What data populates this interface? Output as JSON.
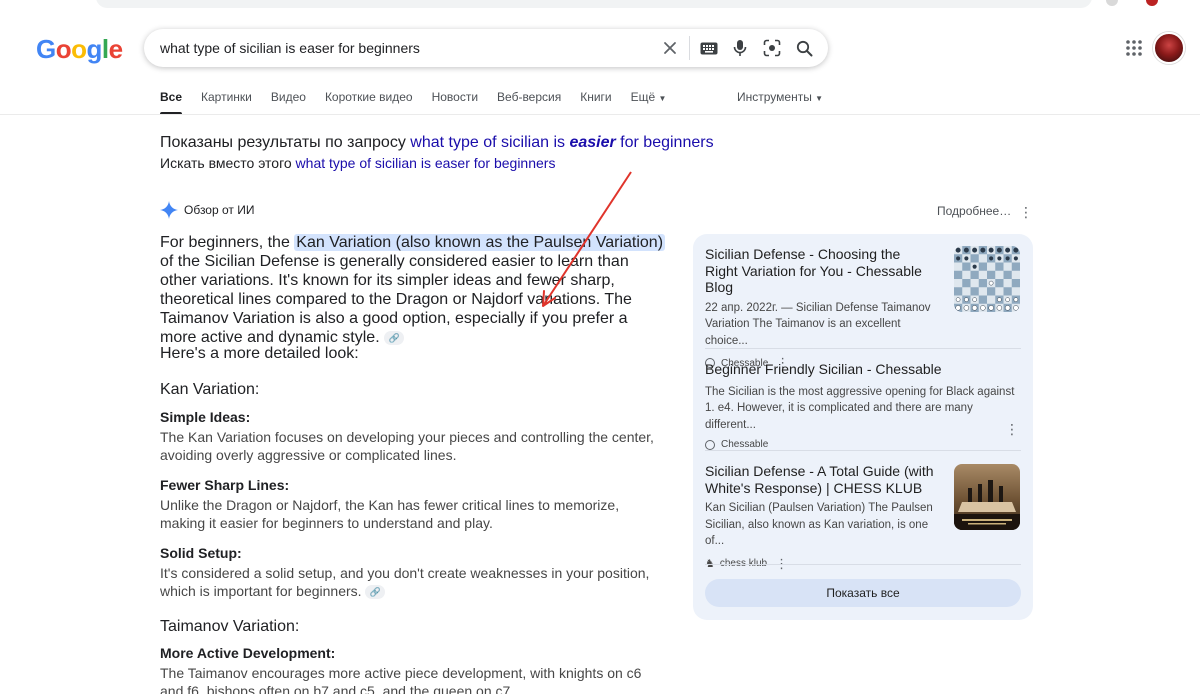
{
  "header": {
    "logo": [
      "G",
      "o",
      "o",
      "g",
      "l",
      "e"
    ],
    "logo_colors": [
      "#4285F4",
      "#EA4335",
      "#FBBC05",
      "#4285F4",
      "#34A853",
      "#EA4335"
    ],
    "search_value": "what type of sicilian is easer for beginners"
  },
  "tabs": [
    {
      "label": "Все",
      "active": true
    },
    {
      "label": "Картинки"
    },
    {
      "label": "Видео"
    },
    {
      "label": "Короткие видео"
    },
    {
      "label": "Новости"
    },
    {
      "label": "Веб-версия"
    },
    {
      "label": "Книги"
    },
    {
      "label": "Ещё"
    }
  ],
  "tools_label": "Инструменты",
  "spelling": {
    "shown_prefix": "Показаны результаты по запросу ",
    "shown_q1": "what type of sicilian is ",
    "shown_q2": "easier",
    "shown_q3": " for beginners",
    "instead_prefix": "Искать вместо этого ",
    "instead_query": "what type of sicilian is easer for beginners"
  },
  "ai": {
    "title": "Обзор от ИИ",
    "more": "Подробнее…",
    "intro_a": "For beginners, the ",
    "intro_hl": "Kan Variation (also known as the Paulsen Variation)",
    "intro_b": " of the Sicilian Defense is generally considered easier to learn than other variations. It's known for its simpler ideas and fewer sharp, theoretical lines compared to the Dragon or Najdorf variations. The Taimanov Variation is also a good option, especially if you prefer a more active and dynamic style.",
    "detail_heading": "Here's a more detailed look:",
    "kan_heading": "Kan Variation:",
    "simple_title": "Simple Ideas:",
    "simple_body": "The Kan Variation focuses on developing your pieces and controlling the center, avoiding overly aggressive or complicated lines.",
    "fewer_title": "Fewer Sharp Lines:",
    "fewer_body": "Unlike the Dragon or Najdorf, the Kan has fewer critical lines to memorize, making it easier for beginners to understand and play.",
    "solid_title": "Solid Setup:",
    "solid_body": "It's considered a solid setup, and you don't create weaknesses in your position, which is important for beginners.",
    "taimanov_heading": "Taimanov Variation:",
    "active_title": "More Active Development:",
    "active_body": "The Taimanov encourages more active piece development, with knights on c6 and f6, bishops often on b7 and c5, and the queen on c7."
  },
  "sources": [
    {
      "title": "Sicilian Defense - Choosing the Right Variation for You - Chessable Blog",
      "snippet": "22 апр. 2022г. — Sicilian Defense Taimanov Variation The Taimanov is an excellent choice...",
      "site": "Chessable"
    },
    {
      "title": "Beginner Friendly Sicilian - Chessable",
      "snippet": "The Sicilian is the most aggressive opening for Black against 1. e4. However, it is complicated and there are many different...",
      "site": "Chessable"
    },
    {
      "title": "Sicilian Defense - A Total Guide (with White's Response) | CHESS KLUB",
      "snippet": "Kan Sicilian (Paulsen Variation) The Paulsen Sicilian, also known as Kan variation, is one of...",
      "site": "chess klub"
    }
  ],
  "show_all": "Показать все",
  "colors": {
    "link": "#1a0dab",
    "highlight": "#d3e3fd",
    "card": "#edf2fa",
    "arrow": "#e0342b"
  }
}
